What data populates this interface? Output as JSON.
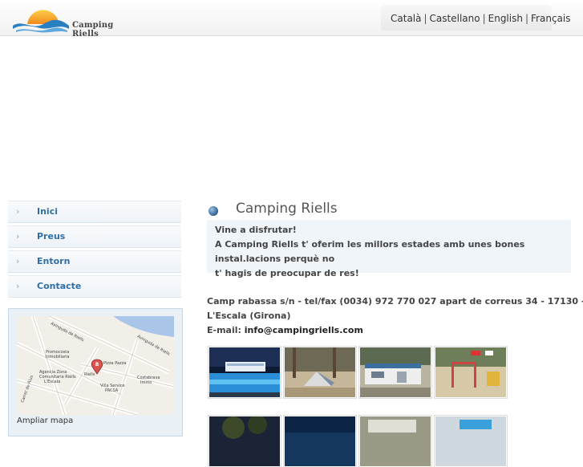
{
  "brand": {
    "logo_text": "Camping Riells"
  },
  "languages": [
    "Català",
    "Castellano",
    "English",
    "Français"
  ],
  "menu": [
    {
      "label": "Inici"
    },
    {
      "label": "Preus"
    },
    {
      "label": "Entorn"
    },
    {
      "label": "Contacte"
    }
  ],
  "map": {
    "link": "Ampliar mapa",
    "labels": {
      "street1": "Avinguda de Riells",
      "promocosta": "Promocosta",
      "inmobiliaria": "Inmobiliaria",
      "pizza": "Pizza Pazza",
      "agencia": "Agencia Zona",
      "comunitaria": "Comunitaria Riells",
      "lescala": "L'Escala",
      "costabrava": "Costabrava",
      "immo": "Immo",
      "villa": "Villa Service",
      "pacsa": "PACSA",
      "street2": "Avinguda de Riells",
      "rius": "Carrer de Rius",
      "riells_label": "Riells",
      "marker": "B"
    }
  },
  "content": {
    "title": "Camping Riells",
    "intro": [
      "Vine a disfrutar!",
      "A Camping Riells t' oferim les millors estades amb unes bones",
      "instal.lacions perquè no",
      "t' hagis de preocupar de res!"
    ],
    "address_line1": "Camp rabassa s/n - tel/fax (0034) 972 770 027 apart de correus 34 - 17130 -",
    "address_line2": "L'Escala (Girona)",
    "email_label": "E-mail:",
    "email": "info@campingriells.com"
  },
  "colors": {
    "menu_text": "#2f6ea6",
    "intro_bg": "#f0f5fa",
    "logo_sun": "#f5a623",
    "logo_wave": "#2a7fc1"
  }
}
